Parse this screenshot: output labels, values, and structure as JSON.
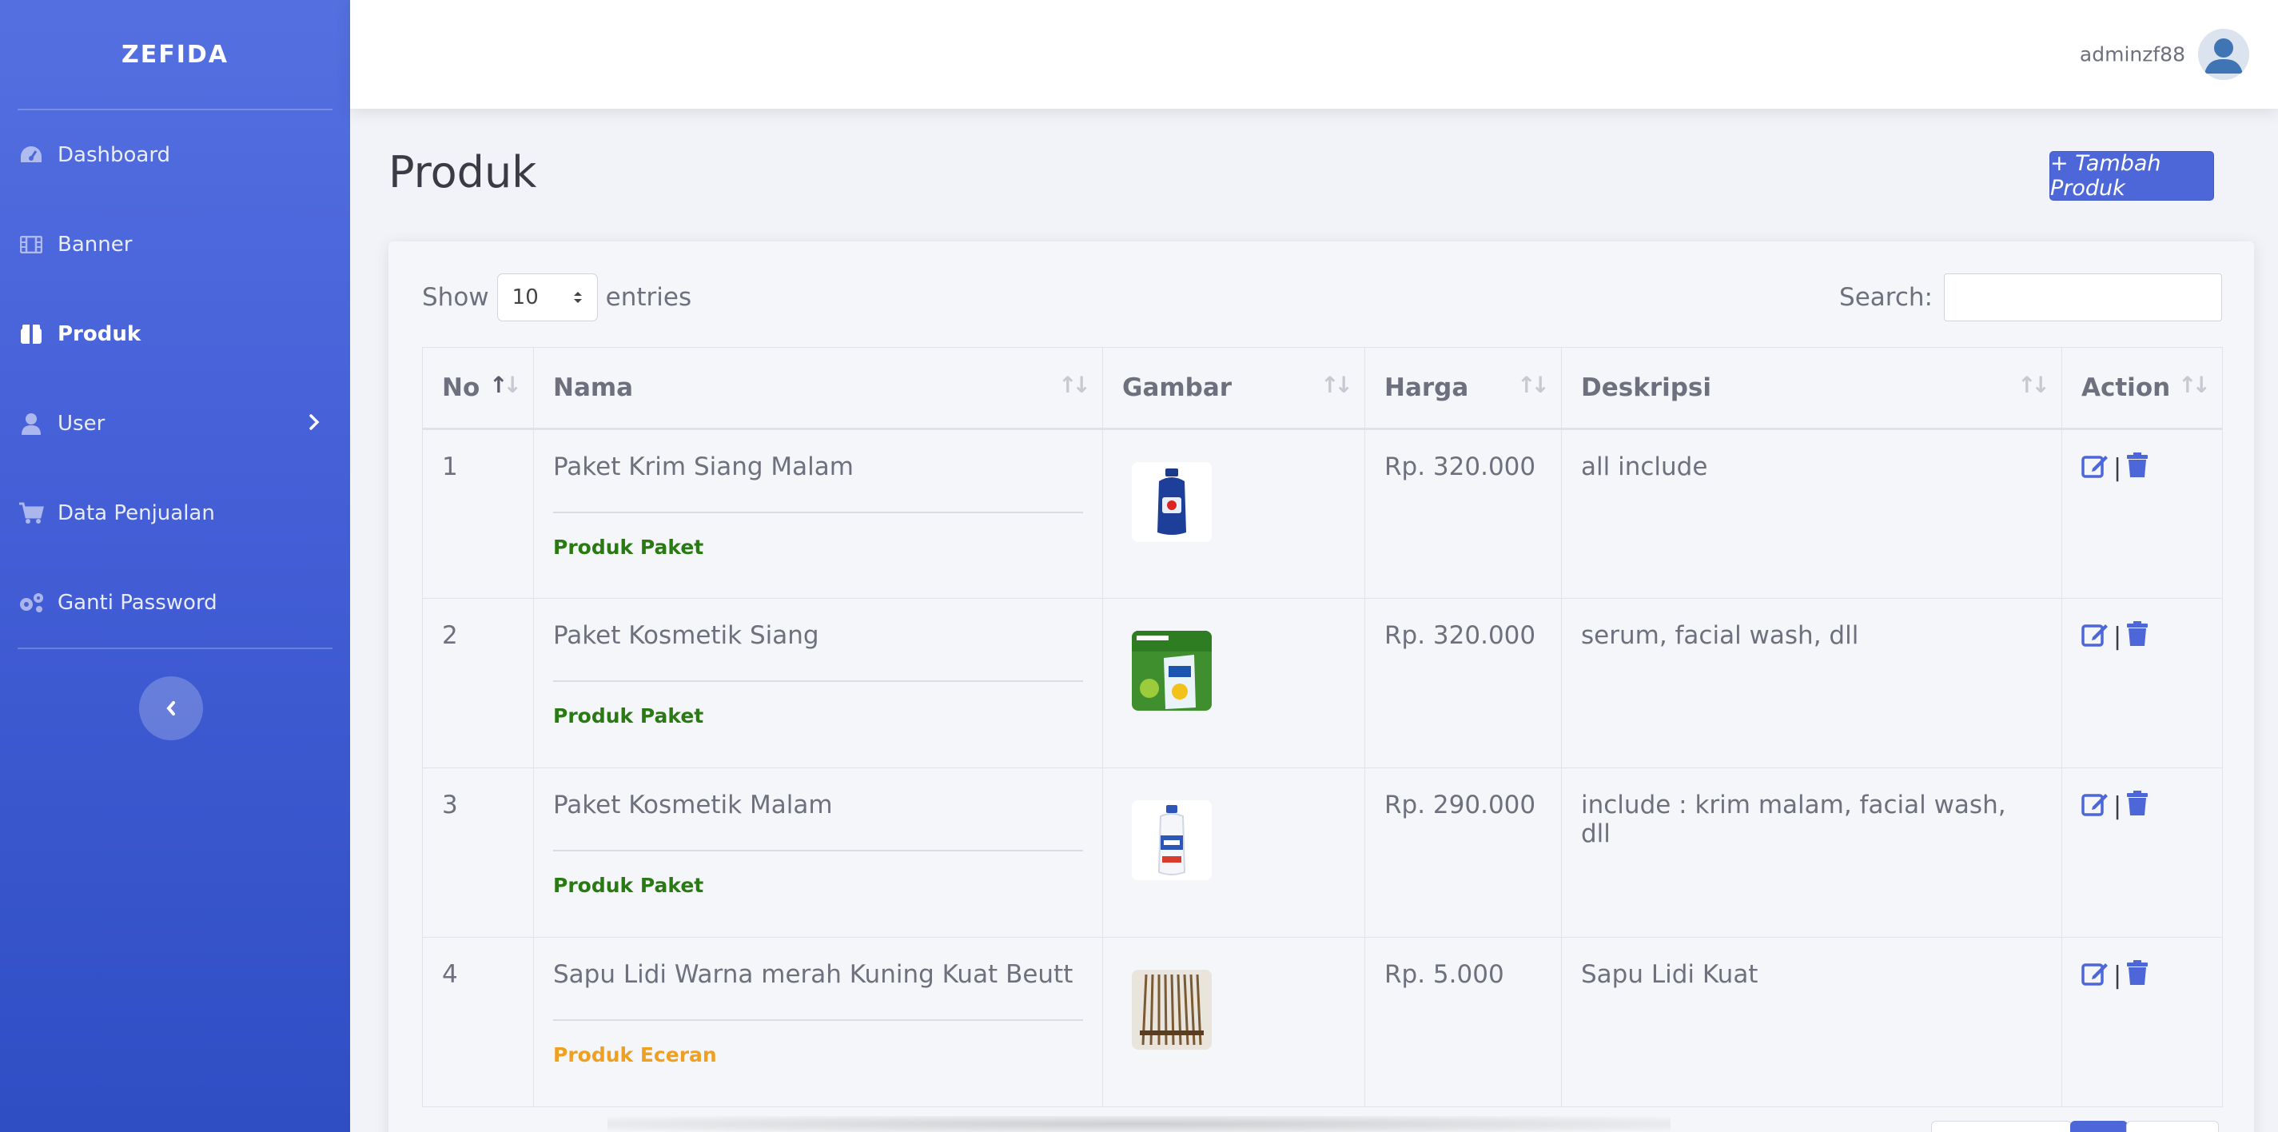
{
  "brand": "ZEFIDA",
  "sidebar": {
    "items": [
      {
        "label": "Dashboard",
        "icon": "dashboard-icon"
      },
      {
        "label": "Banner",
        "icon": "film-icon"
      },
      {
        "label": "Produk",
        "icon": "box-icon",
        "active": true
      },
      {
        "label": "User",
        "icon": "user-icon",
        "has_submenu": true
      },
      {
        "label": "Data Penjualan",
        "icon": "cart-icon"
      },
      {
        "label": "Ganti Password",
        "icon": "cogs-icon"
      }
    ]
  },
  "topbar": {
    "user_name": "adminzf88"
  },
  "page": {
    "title": "Produk",
    "add_button": "+ Tambah Produk"
  },
  "table_controls": {
    "show_label": "Show",
    "entries_value": "10",
    "entries_label": "entries",
    "search_label": "Search:"
  },
  "table": {
    "headers": [
      "No",
      "Nama",
      "Gambar",
      "Harga",
      "Deskripsi",
      "Action"
    ],
    "rows": [
      {
        "no": "1",
        "nama": "Paket Krim Siang Malam",
        "kategori": "Produk Paket",
        "harga": "Rp. 320.000",
        "deskripsi": "all include",
        "image": "detergent-bottle"
      },
      {
        "no": "2",
        "nama": "Paket Kosmetik Siang",
        "kategori": "Produk Paket",
        "harga": "Rp. 320.000",
        "deskripsi": "serum, facial wash, dll",
        "image": "refill-pouch"
      },
      {
        "no": "3",
        "nama": "Paket Kosmetik Malam",
        "kategori": "Produk Paket",
        "harga": "Rp. 290.000",
        "deskripsi": "include : krim malam, facial wash, dll",
        "image": "bleach-bottle"
      },
      {
        "no": "4",
        "nama": "Sapu Lidi Warna merah Kuning Kuat Beutt",
        "kategori": "Produk Eceran",
        "harga": "Rp. 5.000",
        "deskripsi": "Sapu Lidi Kuat",
        "image": "broom-bundle"
      }
    ]
  },
  "colors": {
    "primary": "#4e67d8",
    "tag_paket": "#2a7a13",
    "tag_eceran": "#f0a020"
  }
}
